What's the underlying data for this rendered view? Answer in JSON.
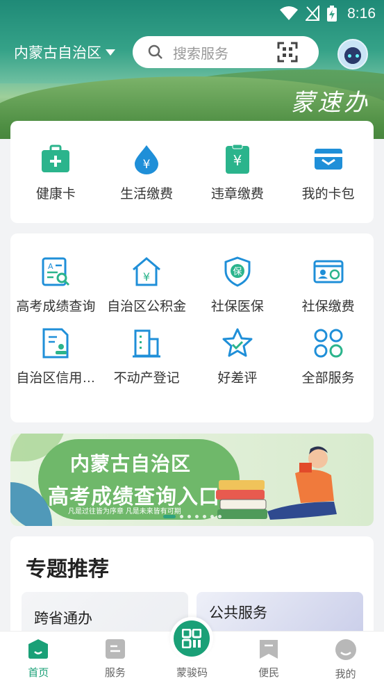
{
  "status_bar": {
    "time": "8:16"
  },
  "header": {
    "region": "内蒙古自治区",
    "search_placeholder": "搜索服务",
    "script_logo": "蒙速办"
  },
  "quick_services": [
    {
      "label": "健康卡",
      "icon": "health-card-icon"
    },
    {
      "label": "生活缴费",
      "icon": "utility-payment-icon"
    },
    {
      "label": "违章缴费",
      "icon": "traffic-fine-icon"
    },
    {
      "label": "我的卡包",
      "icon": "card-wallet-icon"
    }
  ],
  "services": [
    {
      "label": "高考成绩查询",
      "icon": "exam-score-icon"
    },
    {
      "label": "自治区公积金",
      "icon": "housing-fund-icon"
    },
    {
      "label": "社保医保",
      "icon": "social-insurance-icon"
    },
    {
      "label": "社保缴费",
      "icon": "social-insurance-payment-icon"
    },
    {
      "label": "自治区信用…",
      "icon": "credit-icon"
    },
    {
      "label": "不动产登记",
      "icon": "real-estate-icon"
    },
    {
      "label": "好差评",
      "icon": "rating-star-icon"
    },
    {
      "label": "全部服务",
      "icon": "all-services-icon"
    }
  ],
  "banner": {
    "line1": "内蒙古自治区",
    "line2": "高考成绩查询入口",
    "line3": "凡是过往皆为序章  凡是未来皆有可期"
  },
  "topic": {
    "title": "专题推荐",
    "tiles": [
      {
        "label": "跨省通办"
      },
      {
        "label": "公共服务"
      }
    ]
  },
  "tabbar": [
    {
      "label": "首页",
      "active": true,
      "icon": "home-icon"
    },
    {
      "label": "服务",
      "active": false,
      "icon": "service-icon"
    },
    {
      "label": "蒙骏码",
      "active": false,
      "icon": "qr-code-icon"
    },
    {
      "label": "便民",
      "active": false,
      "icon": "bookmark-icon"
    },
    {
      "label": "我的",
      "active": false,
      "icon": "profile-icon"
    }
  ],
  "colors": {
    "accent": "#1aa077",
    "icon_green": "#2bb48c",
    "icon_blue": "#1f8fd8"
  }
}
